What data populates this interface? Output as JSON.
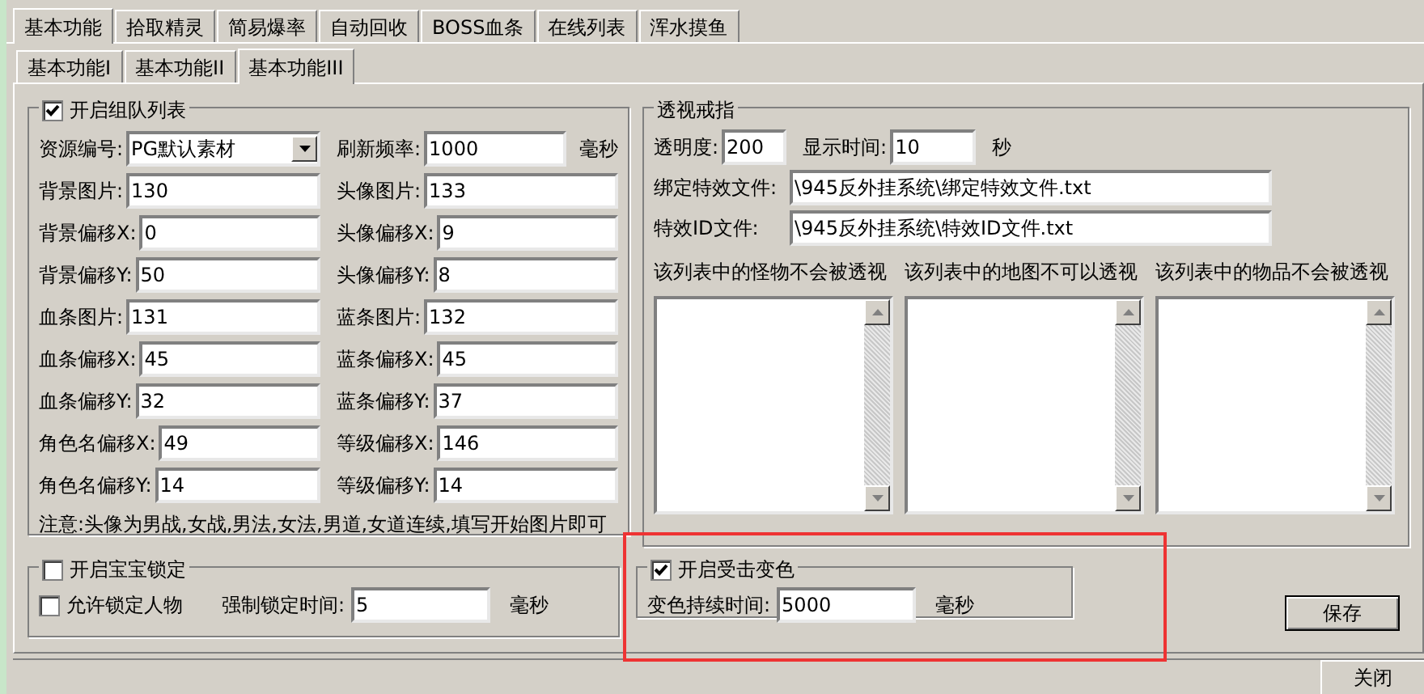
{
  "tabs": [
    {
      "label": "基本功能",
      "selected": true
    },
    {
      "label": "拾取精灵",
      "selected": false
    },
    {
      "label": "简易爆率",
      "selected": false
    },
    {
      "label": "自动回收",
      "selected": false
    },
    {
      "label": "BOSS血条",
      "selected": false
    },
    {
      "label": "在线列表",
      "selected": false
    },
    {
      "label": "浑水摸鱼",
      "selected": false
    }
  ],
  "subtabs": [
    {
      "label": "基本功能Ⅰ",
      "selected": false
    },
    {
      "label": "基本功能II",
      "selected": false
    },
    {
      "label": "基本功能III",
      "selected": true
    }
  ],
  "team_list": {
    "title": "开启组队列表",
    "checked": true,
    "fields": [
      {
        "kind": "select",
        "label": "资源编号:",
        "value": "PG默认素材"
      },
      {
        "kind": "input",
        "label": "刷新频率:",
        "value": "1000",
        "unit": "毫秒"
      },
      {
        "kind": "input",
        "label": "背景图片:",
        "value": "130"
      },
      {
        "kind": "input",
        "label": "头像图片:",
        "value": "133"
      },
      {
        "kind": "input",
        "label": "背景偏移X:",
        "value": "0"
      },
      {
        "kind": "input",
        "label": "头像偏移X:",
        "value": "9"
      },
      {
        "kind": "input",
        "label": "背景偏移Y:",
        "value": "50"
      },
      {
        "kind": "input",
        "label": "头像偏移Y:",
        "value": "8"
      },
      {
        "kind": "input",
        "label": "血条图片:",
        "value": "131"
      },
      {
        "kind": "input",
        "label": "蓝条图片:",
        "value": "132"
      },
      {
        "kind": "input",
        "label": "血条偏移X:",
        "value": "45"
      },
      {
        "kind": "input",
        "label": "蓝条偏移X:",
        "value": "45"
      },
      {
        "kind": "input",
        "label": "血条偏移Y:",
        "value": "32"
      },
      {
        "kind": "input",
        "label": "蓝条偏移Y:",
        "value": "37"
      },
      {
        "kind": "input",
        "label": "角色名偏移X:",
        "value": "49"
      },
      {
        "kind": "input",
        "label": "等级偏移X:",
        "value": "146"
      },
      {
        "kind": "input",
        "label": "角色名偏移Y:",
        "value": "14"
      },
      {
        "kind": "input",
        "label": "等级偏移Y:",
        "value": "14"
      }
    ],
    "note": "注意:头像为男战,女战,男法,女法,男道,女道连续,填写开始图片即可"
  },
  "xray_ring": {
    "title": "透视戒指",
    "transparency": {
      "label": "透明度:",
      "value": "200"
    },
    "display_time": {
      "label": "显示时间:",
      "value": "10",
      "unit": "秒"
    },
    "files": [
      {
        "label": "绑定特效文件:",
        "value": "\\945反外挂系统\\绑定特效文件.txt"
      },
      {
        "label": "特效ID文件:",
        "value": "\\945反外挂系统\\特效ID文件.txt"
      }
    ],
    "lists": [
      {
        "label": "该列表中的怪物不会被透视"
      },
      {
        "label": "该列表中的地图不可以透视"
      },
      {
        "label": "该列表中的物品不会被透视"
      }
    ]
  },
  "pet_lock": {
    "title": "开启宝宝锁定",
    "checked": false,
    "lock_player": {
      "label": "允许锁定人物",
      "checked": false
    },
    "force_time": {
      "label": "强制锁定时间:",
      "value": "5",
      "unit": "毫秒"
    }
  },
  "hit_color": {
    "title": "开启受击变色",
    "checked": true,
    "duration": {
      "label": "变色持续时间:",
      "value": "5000",
      "unit": "毫秒"
    }
  },
  "save_button": "保存",
  "close_button": "关闭"
}
